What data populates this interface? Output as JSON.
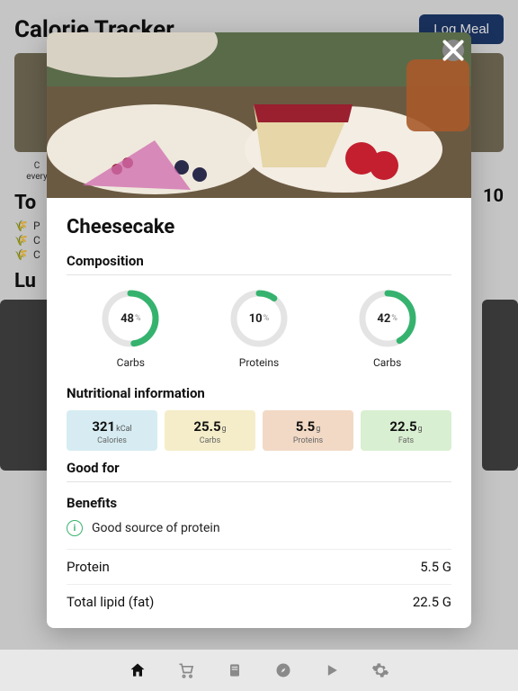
{
  "header": {
    "title": "Calorie Tracker",
    "log_button": "Log Meal"
  },
  "bg": {
    "caption_line1": "C",
    "caption_line2": "every",
    "today_label": "To",
    "today_value": "10",
    "macro1": "P",
    "macro2": "C",
    "macro3": "C",
    "lunch_label": "Lu"
  },
  "modal": {
    "title": "Cheesecake",
    "composition_label": "Composition",
    "comp": [
      {
        "value": 48,
        "label": "Carbs"
      },
      {
        "value": 10,
        "label": "Proteins"
      },
      {
        "value": 42,
        "label": "Carbs"
      }
    ],
    "nutritional_label": "Nutritional information",
    "cards": {
      "calories": {
        "value": "321",
        "unit": "kCal",
        "label": "Calories"
      },
      "carbs": {
        "value": "25.5",
        "unit": "g",
        "label": "Carbs"
      },
      "proteins": {
        "value": "5.5",
        "unit": "g",
        "label": "Proteins"
      },
      "fats": {
        "value": "22.5",
        "unit": "g",
        "label": "Fats"
      }
    },
    "good_for_label": "Good for",
    "benefits_label": "Benefits",
    "benefit_text": "Good source of protein",
    "rows": [
      {
        "name": "Protein",
        "value": "5.5 G"
      },
      {
        "name": "Total lipid (fat)",
        "value": "22.5 G"
      }
    ]
  },
  "nav": [
    "home",
    "cart",
    "recipe",
    "compass",
    "play",
    "settings"
  ]
}
